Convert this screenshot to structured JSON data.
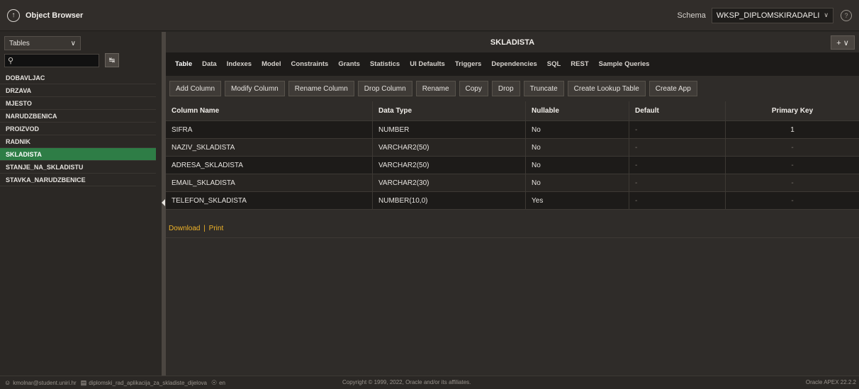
{
  "header": {
    "app_title": "Object Browser",
    "schema_label": "Schema",
    "schema_value": "WKSP_DIPLOMSKIRADAPLI",
    "up_icon": "arrow-up-circle-icon",
    "help_icon": "help-circle-icon"
  },
  "sidebar": {
    "object_type": "Tables",
    "search_value": "",
    "items": [
      {
        "label": "DOBAVLJAC"
      },
      {
        "label": "DRZAVA"
      },
      {
        "label": "MJESTO"
      },
      {
        "label": "NARUDZBENICA"
      },
      {
        "label": "PROIZVOD"
      },
      {
        "label": "RADNIK"
      },
      {
        "label": "SKLADISTA"
      },
      {
        "label": "STANJE_NA_SKLADISTU"
      },
      {
        "label": "STAVKA_NARUDZBENICE"
      }
    ],
    "selected_index": 6,
    "accent": "#2e7d46"
  },
  "main": {
    "title": "SKLADISTA",
    "add_label": "+ ∨",
    "tabs": [
      {
        "label": "Table"
      },
      {
        "label": "Data"
      },
      {
        "label": "Indexes"
      },
      {
        "label": "Model"
      },
      {
        "label": "Constraints"
      },
      {
        "label": "Grants"
      },
      {
        "label": "Statistics"
      },
      {
        "label": "UI Defaults"
      },
      {
        "label": "Triggers"
      },
      {
        "label": "Dependencies"
      },
      {
        "label": "SQL"
      },
      {
        "label": "REST"
      },
      {
        "label": "Sample Queries"
      }
    ],
    "active_tab": 0,
    "toolbar": [
      {
        "label": "Add Column"
      },
      {
        "label": "Modify Column"
      },
      {
        "label": "Rename Column"
      },
      {
        "label": "Drop Column"
      },
      {
        "label": "Rename"
      },
      {
        "label": "Copy"
      },
      {
        "label": "Drop"
      },
      {
        "label": "Truncate"
      },
      {
        "label": "Create Lookup Table"
      },
      {
        "label": "Create App"
      }
    ],
    "columns": [
      "Column Name",
      "Data Type",
      "Nullable",
      "Default",
      "Primary Key"
    ],
    "rows": [
      {
        "name": "SIFRA",
        "type": "NUMBER",
        "nullable": "No",
        "default": "-",
        "pk": "1"
      },
      {
        "name": "NAZIV_SKLADISTA",
        "type": "VARCHAR2(50)",
        "nullable": "No",
        "default": "-",
        "pk": "-"
      },
      {
        "name": "ADRESA_SKLADISTA",
        "type": "VARCHAR2(50)",
        "nullable": "No",
        "default": "-",
        "pk": "-"
      },
      {
        "name": "EMAIL_SKLADISTA",
        "type": "VARCHAR2(30)",
        "nullable": "No",
        "default": "-",
        "pk": "-"
      },
      {
        "name": "TELEFON_SKLADISTA",
        "type": "NUMBER(10,0)",
        "nullable": "Yes",
        "default": "-",
        "pk": "-"
      }
    ],
    "download_label": "Download",
    "link_separator": "|",
    "print_label": "Print"
  },
  "footer": {
    "user": "kmolnar@student.uniri.hr",
    "workspace": "diplomski_rad_aplikacija_za_skladiste_dijelova",
    "language": "en",
    "copyright": "Copyright © 1999, 2022, Oracle and/or its affiliates.",
    "version": "Oracle APEX 22.2.2"
  }
}
